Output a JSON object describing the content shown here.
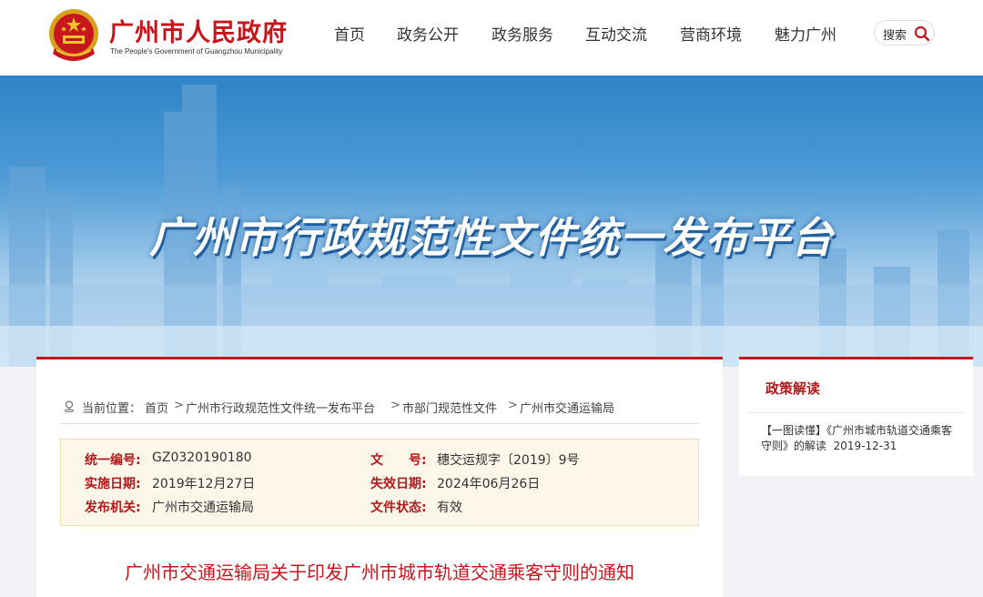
{
  "header": {
    "title": "广州市人民政府",
    "subtitle": "The People's Government of Guangzhou Municipality",
    "nav": [
      "首页",
      "政务公开",
      "政务服务",
      "互动交流",
      "营商环境",
      "魅力广州"
    ],
    "search_label": "搜索"
  },
  "banner": {
    "title": "广州市行政规范性文件统一发布平台"
  },
  "breadcrumb": {
    "label": "当前位置：",
    "items": [
      "首页",
      "广州市行政规范性文件统一发布平台",
      "市部门规范性文件",
      "广州市交通运输局"
    ],
    "separator": ">"
  },
  "meta": {
    "unified_no_label": "统一编号:",
    "unified_no": "GZ0320190180",
    "doc_no_label": "文　　号:",
    "doc_no": "穗交运规字〔2019〕9号",
    "effective_label": "实施日期:",
    "effective_date": "2019年12月27日",
    "expiry_label": "失效日期:",
    "expiry_date": "2024年06月26日",
    "issuer_label": "发布机关:",
    "issuer": "广州市交通运输局",
    "status_label": "文件状态:",
    "status": "有效"
  },
  "document": {
    "title": "广州市交通运输局关于印发广州市城市轨道交通乘客守则的通知"
  },
  "sidebar": {
    "title": "政策解读",
    "link_text": "【一图读懂】《广州市城市轨道交通乘客守则》的解读",
    "link_date": "2019-12-31"
  },
  "colors": {
    "brand_red": "#c5161d",
    "meta_bg": "#fdf7e9",
    "banner_blue": "#3b8fd0"
  }
}
